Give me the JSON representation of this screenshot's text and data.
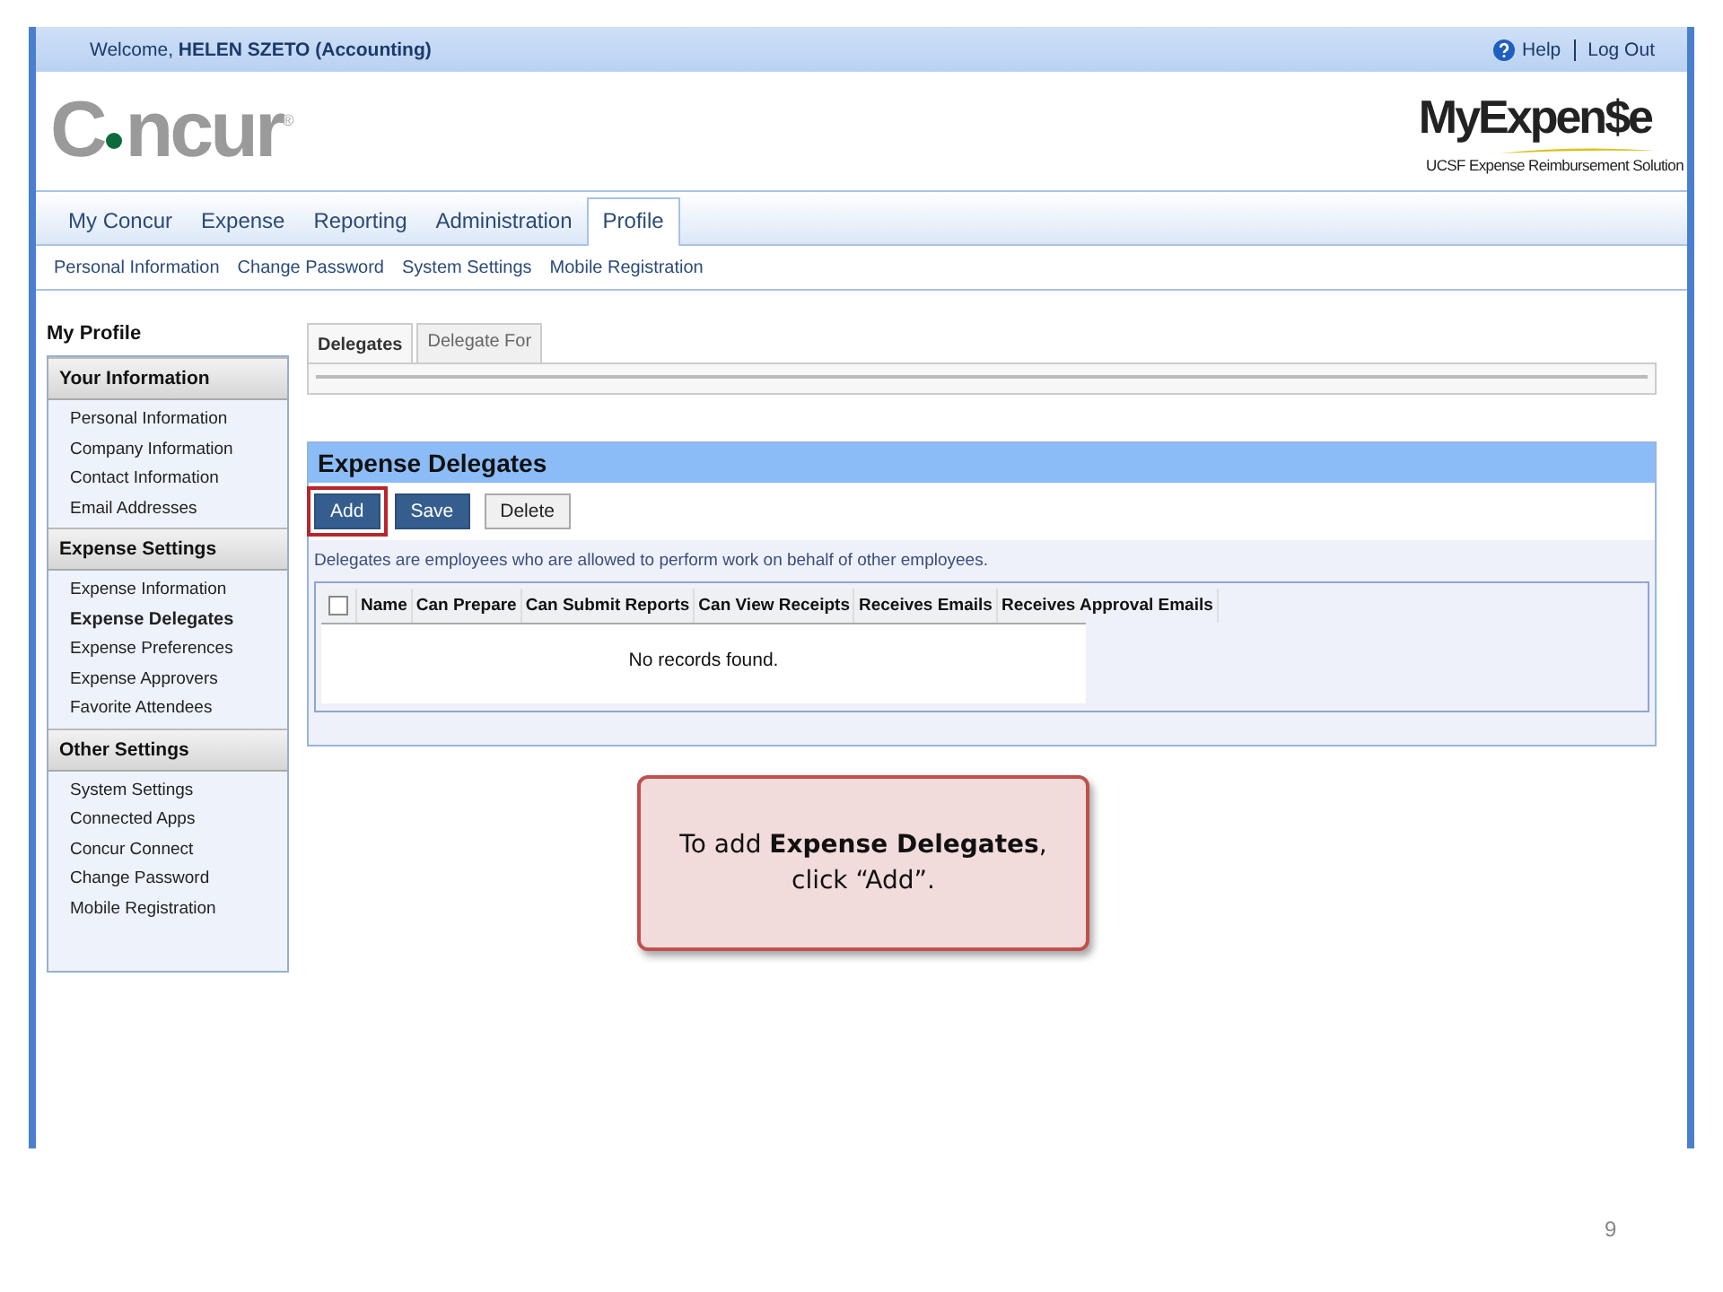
{
  "top_bar": {
    "welcome": "Welcome, **HELEN SZETO (Accounting)**",
    "help": "Help",
    "logout": "Log Out"
  },
  "header": {
    "logo_start": "C",
    "logo_end": "ncur",
    "logo_mark": "®",
    "brand": "MyExpen$e",
    "brand_subtitle": "UCSF Expense Reimbursement Solution"
  },
  "nav_tabs": [
    {
      "label": "My Concur",
      "selected": false
    },
    {
      "label": "Expense",
      "selected": false
    },
    {
      "label": "Reporting",
      "selected": false
    },
    {
      "label": "Administration",
      "selected": false
    },
    {
      "label": "Profile",
      "selected": true
    }
  ],
  "sub_nav": [
    "Personal Information",
    "Change Password",
    "System Settings",
    "Mobile Registration"
  ],
  "sidebar": {
    "title": "My Profile",
    "sections": [
      {
        "title": "Your Information",
        "items": [
          {
            "label": "Personal Information",
            "selected": false
          },
          {
            "label": "Company Information",
            "selected": false
          },
          {
            "label": "Contact Information",
            "selected": false
          },
          {
            "label": "Email Addresses",
            "selected": false
          }
        ]
      },
      {
        "title": "Expense Settings",
        "items": [
          {
            "label": "Expense Information",
            "selected": false
          },
          {
            "label": "Expense Delegates",
            "selected": true
          },
          {
            "label": "Expense Preferences",
            "selected": false
          },
          {
            "label": "Expense Approvers",
            "selected": false
          },
          {
            "label": "Favorite Attendees",
            "selected": false
          }
        ]
      },
      {
        "title": "Other Settings",
        "items": [
          {
            "label": "System Settings",
            "selected": false
          },
          {
            "label": "Connected Apps",
            "selected": false
          },
          {
            "label": "Concur Connect",
            "selected": false
          },
          {
            "label": "Change Password",
            "selected": false
          },
          {
            "label": "Mobile Registration",
            "selected": false
          }
        ]
      }
    ]
  },
  "content_tabs": [
    {
      "label": "Delegates",
      "selected": true
    },
    {
      "label": "Delegate For",
      "selected": false
    }
  ],
  "panel": {
    "title": "Expense Delegates",
    "buttons": [
      {
        "label": "Add",
        "kind": "primary",
        "highlighted": true
      },
      {
        "label": "Save",
        "kind": "primary",
        "highlighted": false
      },
      {
        "label": "Delete",
        "kind": "secondary",
        "highlighted": false
      }
    ],
    "description": "Delegates are employees who are allowed to perform work on behalf of other employees.",
    "table": {
      "select_all": {
        "checked": false
      },
      "columns": [
        "Name",
        "Can Prepare",
        "Can Submit Reports",
        "Can View Receipts",
        "Receives Emails",
        "Receives Approval Emails"
      ],
      "empty_message": "No records found."
    }
  },
  "callout": "To add **Expense Delegates**,\nclick “Add”.",
  "page_number": "9"
}
